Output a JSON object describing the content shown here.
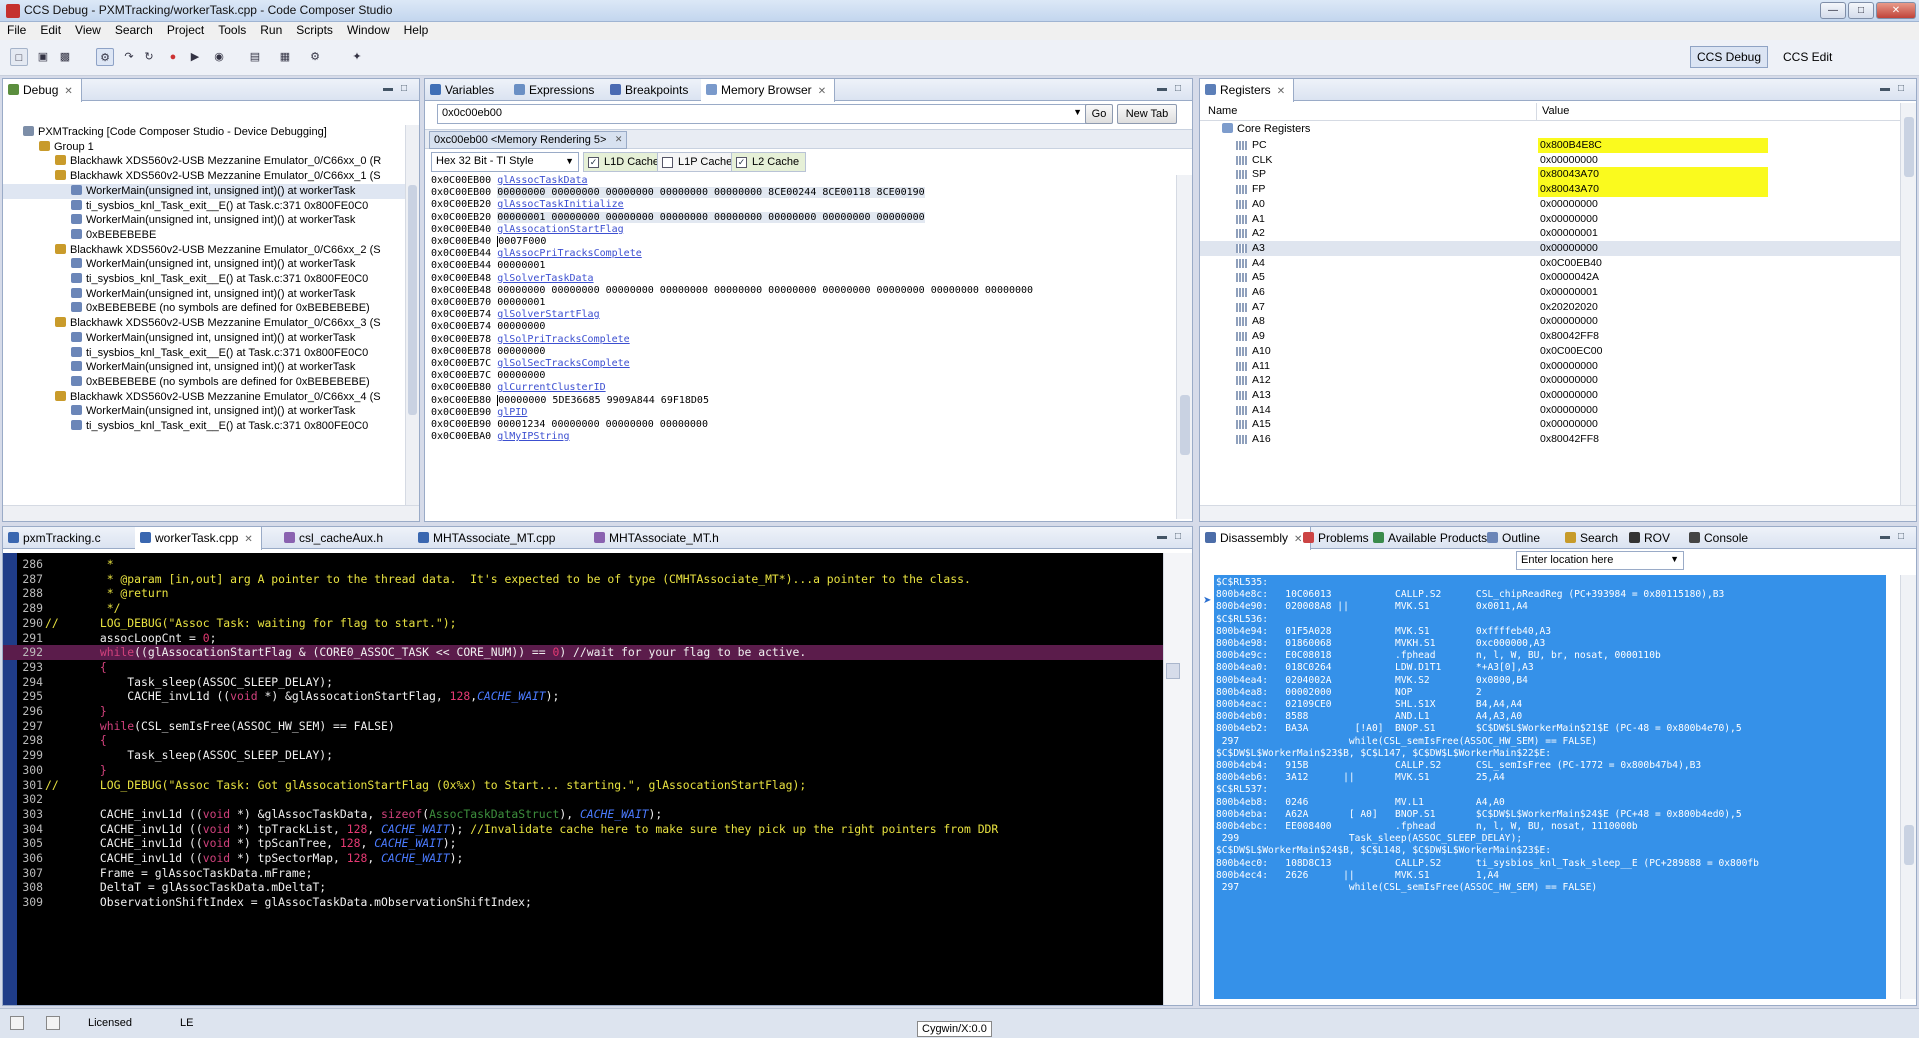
{
  "window": {
    "title": "CCS Debug - PXMTracking/workerTask.cpp - Code Composer Studio"
  },
  "menu": [
    "File",
    "Edit",
    "View",
    "Search",
    "Project",
    "Tools",
    "Run",
    "Scripts",
    "Window",
    "Help"
  ],
  "perspectives": [
    "CCS Debug",
    "CCS Edit"
  ],
  "debug_view": {
    "tab": "Debug",
    "rows": [
      {
        "indent": 0,
        "icon": "debug-session",
        "text": "PXMTracking [Code Composer Studio - Device Debugging]"
      },
      {
        "indent": 1,
        "icon": "group",
        "text": "Group 1"
      },
      {
        "indent": 2,
        "icon": "emulator",
        "text": "Blackhawk XDS560v2-USB Mezzanine Emulator_0/C66xx_0 (R"
      },
      {
        "indent": 2,
        "icon": "emulator",
        "text": "Blackhawk XDS560v2-USB Mezzanine Emulator_0/C66xx_1 (S"
      },
      {
        "indent": 3,
        "icon": "stack-frame",
        "text": "WorkerMain(unsigned int, unsigned int)() at workerTask",
        "selected": true
      },
      {
        "indent": 3,
        "icon": "stack-frame",
        "text": "ti_sysbios_knl_Task_exit__E() at Task.c:371 0x800FE0C0"
      },
      {
        "indent": 3,
        "icon": "stack-frame",
        "text": "WorkerMain(unsigned int, unsigned int)() at workerTask"
      },
      {
        "indent": 3,
        "icon": "stack-frame",
        "text": "0xBEBEBEBE"
      },
      {
        "indent": 2,
        "icon": "emulator",
        "text": "Blackhawk XDS560v2-USB Mezzanine Emulator_0/C66xx_2 (S"
      },
      {
        "indent": 3,
        "icon": "stack-frame",
        "text": "WorkerMain(unsigned int, unsigned int)() at workerTask"
      },
      {
        "indent": 3,
        "icon": "stack-frame",
        "text": "ti_sysbios_knl_Task_exit__E() at Task.c:371 0x800FE0C0"
      },
      {
        "indent": 3,
        "icon": "stack-frame",
        "text": "WorkerMain(unsigned int, unsigned int)() at workerTask"
      },
      {
        "indent": 3,
        "icon": "stack-frame",
        "text": "0xBEBEBEBE  (no symbols are defined for 0xBEBEBEBE)"
      },
      {
        "indent": 2,
        "icon": "emulator",
        "text": "Blackhawk XDS560v2-USB Mezzanine Emulator_0/C66xx_3 (S"
      },
      {
        "indent": 3,
        "icon": "stack-frame",
        "text": "WorkerMain(unsigned int, unsigned int)() at workerTask"
      },
      {
        "indent": 3,
        "icon": "stack-frame",
        "text": "ti_sysbios_knl_Task_exit__E() at Task.c:371 0x800FE0C0"
      },
      {
        "indent": 3,
        "icon": "stack-frame",
        "text": "WorkerMain(unsigned int, unsigned int)() at workerTask"
      },
      {
        "indent": 3,
        "icon": "stack-frame",
        "text": "0xBEBEBEBE  (no symbols are defined for 0xBEBEBEBE)"
      },
      {
        "indent": 2,
        "icon": "emulator",
        "text": "Blackhawk XDS560v2-USB Mezzanine Emulator_0/C66xx_4 (S"
      },
      {
        "indent": 3,
        "icon": "stack-frame",
        "text": "WorkerMain(unsigned int, unsigned int)() at workerTask"
      },
      {
        "indent": 3,
        "icon": "stack-frame",
        "text": "ti_sysbios_knl_Task_exit__E() at Task.c:371 0x800FE0C0"
      }
    ]
  },
  "memory_view": {
    "tabs": [
      "Variables",
      "Expressions",
      "Breakpoints",
      "Memory Browser"
    ],
    "address": "0x0c00eb00",
    "go_label": "Go",
    "newtab_label": "New Tab",
    "rendering_tab": "0xc00eb00 <Memory Rendering 5>",
    "format": "Hex 32 Bit - TI Style",
    "caches": [
      {
        "label": "L1D Cache",
        "checked": true
      },
      {
        "label": "L1P Cache",
        "checked": false
      },
      {
        "label": "L2 Cache",
        "checked": true
      }
    ],
    "rows": [
      {
        "addr": "0x0C00EB00",
        "sym": "glAssocTaskData"
      },
      {
        "addr": "0x0C00EB00",
        "data": "00000000 00000000 00000000 00000000 00000000 8CE00244 8CE00118 8CE00190",
        "sel": true
      },
      {
        "addr": "0x0C00EB20",
        "sym": "glAssocTaskInitialize"
      },
      {
        "addr": "0x0C00EB20",
        "data": "00000001 00000000 00000000 00000000 00000000 00000000 00000000 00000000",
        "sel": true
      },
      {
        "addr": "0x0C00EB40",
        "sym": "glAssocationStartFlag"
      },
      {
        "addr": "0x0C00EB40",
        "data": "0007F000",
        "cursor": true
      },
      {
        "addr": "0x0C00EB44",
        "sym": "glAssocPriTracksComplete"
      },
      {
        "addr": "0x0C00EB44",
        "data": "00000001"
      },
      {
        "addr": "0x0C00EB48",
        "sym": "glSolverTaskData"
      },
      {
        "addr": "0x0C00EB48",
        "data": "00000000 00000000 00000000 00000000 00000000 00000000 00000000 00000000 00000000 00000000"
      },
      {
        "addr": "0x0C00EB70",
        "data": "00000001"
      },
      {
        "addr": "0x0C00EB74",
        "sym": "glSolverStartFlag"
      },
      {
        "addr": "0x0C00EB74",
        "data": "00000000"
      },
      {
        "addr": "0x0C00EB78",
        "sym": "glSolPriTracksComplete"
      },
      {
        "addr": "0x0C00EB78",
        "data": "00000000"
      },
      {
        "addr": "0x0C00EB7C",
        "sym": "glSolSecTracksComplete"
      },
      {
        "addr": "0x0C00EB7C",
        "data": "00000000"
      },
      {
        "addr": "0x0C00EB80",
        "sym": "glCurrentClusterID"
      },
      {
        "addr": "0x0C00EB80",
        "data": "00000000 5DE36685 9909A844 69F18D05",
        "cursor": true
      },
      {
        "addr": "0x0C00EB90",
        "sym": "glPID"
      },
      {
        "addr": "0x0C00EB90",
        "data": "00001234 00000000 00000000 00000000"
      },
      {
        "addr": "0x0C00EBA0",
        "sym": "glMyIPString"
      }
    ]
  },
  "registers_view": {
    "tab": "Registers",
    "col_name": "Name",
    "col_value": "Value",
    "group": "Core Registers",
    "regs": [
      {
        "name": "PC",
        "value": "0x800B4E8C",
        "hl": true
      },
      {
        "name": "CLK",
        "value": "0x00000000"
      },
      {
        "name": "SP",
        "value": "0x80043A70",
        "hl": true
      },
      {
        "name": "FP",
        "value": "0x80043A70",
        "hl": true
      },
      {
        "name": "A0",
        "value": "0x00000000"
      },
      {
        "name": "A1",
        "value": "0x00000000"
      },
      {
        "name": "A2",
        "value": "0x00000001"
      },
      {
        "name": "A3",
        "value": "0x00000000",
        "sel": true
      },
      {
        "name": "A4",
        "value": "0x0C00EB40"
      },
      {
        "name": "A5",
        "value": "0x0000042A"
      },
      {
        "name": "A6",
        "value": "0x00000001"
      },
      {
        "name": "A7",
        "value": "0x20202020"
      },
      {
        "name": "A8",
        "value": "0x00000000"
      },
      {
        "name": "A9",
        "value": "0x80042FF8"
      },
      {
        "name": "A10",
        "value": "0x0C00EC00"
      },
      {
        "name": "A11",
        "value": "0x00000000"
      },
      {
        "name": "A12",
        "value": "0x00000000"
      },
      {
        "name": "A13",
        "value": "0x00000000"
      },
      {
        "name": "A14",
        "value": "0x00000000"
      },
      {
        "name": "A15",
        "value": "0x00000000"
      },
      {
        "name": "A16",
        "value": "0x80042FF8"
      }
    ]
  },
  "editor": {
    "tabs": [
      "pxmTracking.c",
      "workerTask.cpp",
      "csl_cacheAux.h",
      "MHTAssociate_MT.cpp",
      "MHTAssociate_MT.h"
    ],
    "lines": [
      {
        "n": "286",
        "t": [
          [
            "c-cmt",
            "         *"
          ]
        ]
      },
      {
        "n": "287",
        "t": [
          [
            "c-cmt",
            "         * @param [in,out] arg A pointer to the thread data.  It's expected to be of type (CMHTAssociate_MT*)...a pointer to the class."
          ]
        ]
      },
      {
        "n": "288",
        "t": [
          [
            "c-cmt",
            "         * @return"
          ]
        ]
      },
      {
        "n": "289",
        "t": [
          [
            "c-cmt",
            "         */"
          ]
        ]
      },
      {
        "n": "290",
        "t": [
          [
            "c-cmt",
            "//      LOG_DEBUG(\"Assoc Task: waiting for flag to start.\");"
          ]
        ]
      },
      {
        "n": "291",
        "t": [
          [
            "",
            "        assocLoopCnt = "
          ],
          [
            "c-num",
            "0"
          ],
          [
            "",
            ";"
          ]
        ]
      },
      {
        "n": "292",
        "hl": true,
        "t": [
          [
            "c-kw",
            "        while"
          ],
          [
            "",
            "((glAssocationStartFlag & (CORE0_ASSOC_TASK << CORE_NUM)) == "
          ],
          [
            "c-num",
            "0"
          ],
          [
            "",
            ") //wait for your flag to be active."
          ]
        ]
      },
      {
        "n": "293",
        "t": [
          [
            "c-kw",
            "        {"
          ]
        ]
      },
      {
        "n": "294",
        "t": [
          [
            "",
            "            Task_sleep(ASSOC_SLEEP_DELAY);"
          ]
        ]
      },
      {
        "n": "295",
        "t": [
          [
            "",
            "            CACHE_invL1d (("
          ],
          [
            "c-kw",
            "void"
          ],
          [
            "",
            " *) &glAssocationStartFlag, "
          ],
          [
            "c-num",
            "128"
          ],
          [
            "",
            ","
          ],
          [
            "c-mac",
            "CACHE_WAIT"
          ],
          [
            "",
            ");"
          ]
        ]
      },
      {
        "n": "296",
        "t": [
          [
            "c-kw",
            "        }"
          ]
        ]
      },
      {
        "n": "297",
        "t": [
          [
            "c-kw",
            "        while"
          ],
          [
            "",
            "(CSL_semIsFree(ASSOC_HW_SEM) == FALSE)"
          ]
        ]
      },
      {
        "n": "298",
        "t": [
          [
            "c-kw",
            "        {"
          ]
        ]
      },
      {
        "n": "299",
        "t": [
          [
            "",
            "            Task_sleep(ASSOC_SLEEP_DELAY);"
          ]
        ]
      },
      {
        "n": "300",
        "t": [
          [
            "c-kw",
            "        }"
          ]
        ]
      },
      {
        "n": "301",
        "t": [
          [
            "c-cmt",
            "//      LOG_DEBUG(\"Assoc Task: Got glAssocationStartFlag (0x%x) to Start... starting.\", glAssocationStartFlag);"
          ]
        ]
      },
      {
        "n": "302",
        "t": [
          [
            "",
            ""
          ]
        ]
      },
      {
        "n": "303",
        "t": [
          [
            "",
            "        CACHE_invL1d (("
          ],
          [
            "c-kw",
            "void"
          ],
          [
            "",
            " *) &glAssocTaskData, "
          ],
          [
            "c-kw",
            "sizeof"
          ],
          [
            "",
            "("
          ],
          [
            "c-grn",
            "AssocTaskDataStruct"
          ],
          [
            "",
            "), "
          ],
          [
            "c-mac",
            "CACHE_WAIT"
          ],
          [
            "",
            ");"
          ]
        ]
      },
      {
        "n": "304",
        "t": [
          [
            "",
            "        CACHE_invL1d (("
          ],
          [
            "c-kw",
            "void"
          ],
          [
            "",
            " *) tpTrackList, "
          ],
          [
            "c-num",
            "128"
          ],
          [
            "",
            ", "
          ],
          [
            "c-mac",
            "CACHE_WAIT"
          ],
          [
            "",
            "); "
          ],
          [
            "c-cmt",
            "//Invalidate cache here to make sure they pick up the right pointers from DDR"
          ]
        ]
      },
      {
        "n": "305",
        "t": [
          [
            "",
            "        CACHE_invL1d (("
          ],
          [
            "c-kw",
            "void"
          ],
          [
            "",
            " *) tpScanTree, "
          ],
          [
            "c-num",
            "128"
          ],
          [
            "",
            ", "
          ],
          [
            "c-mac",
            "CACHE_WAIT"
          ],
          [
            "",
            ");"
          ]
        ]
      },
      {
        "n": "306",
        "t": [
          [
            "",
            "        CACHE_invL1d (("
          ],
          [
            "c-kw",
            "void"
          ],
          [
            "",
            " *) tpSectorMap, "
          ],
          [
            "c-num",
            "128"
          ],
          [
            "",
            ", "
          ],
          [
            "c-mac",
            "CACHE_WAIT"
          ],
          [
            "",
            ");"
          ]
        ]
      },
      {
        "n": "307",
        "t": [
          [
            "",
            "        Frame = glAssocTaskData.mFrame;"
          ]
        ]
      },
      {
        "n": "308",
        "t": [
          [
            "",
            "        DeltaT = glAssocTaskData.mDeltaT;"
          ]
        ]
      },
      {
        "n": "309",
        "t": [
          [
            "",
            "        ObservationShiftIndex = glAssocTaskData.mObservationShiftIndex;"
          ]
        ]
      }
    ]
  },
  "bottom_views": {
    "tabs": [
      "Disassembly",
      "Problems",
      "Available Products",
      "Outline",
      "Search",
      "ROV",
      "Console"
    ],
    "location_placeholder": "Enter location here",
    "lines": [
      "$C$RL535:",
      "800b4e8c:   10C06013           CALLP.S2      CSL_chipReadReg (PC+393984 = 0x80115180),B3",
      "800b4e90:   020008A8 ||        MVK.S1        0x0011,A4",
      "$C$RL536:",
      "800b4e94:   01F5A028           MVK.S1        0xffffeb40,A3",
      "800b4e98:   01860068           MVKH.S1       0xc000000,A3",
      "800b4e9c:   E0C08018           .fphead       n, l, W, BU, br, nosat, 0000110b",
      "800b4ea0:   018C0264           LDW.D1T1      *+A3[0],A3",
      "800b4ea4:   0204002A           MVK.S2        0x0800,B4",
      "800b4ea8:   00002000           NOP           2",
      "800b4eac:   02109CE0           SHL.S1X       B4,A4,A4",
      "800b4eb0:   8588               AND.L1        A4,A3,A0",
      "800b4eb2:   BA3A        [!A0]  BNOP.S1       $C$DW$L$WorkerMain$21$E (PC-48 = 0x800b4e70),5",
      " 297                   while(CSL_semIsFree(ASSOC_HW_SEM) == FALSE)",
      "$C$DW$L$WorkerMain$23$B, $C$L147, $C$DW$L$WorkerMain$22$E:",
      "800b4eb4:   915B               CALLP.S2      CSL_semIsFree (PC-1772 = 0x800b47b4),B3",
      "800b4eb6:   3A12      ||       MVK.S1        25,A4",
      "$C$RL537:",
      "800b4eb8:   0246               MV.L1         A4,A0",
      "800b4eba:   A62A       [ A0]   BNOP.S1       $C$DW$L$WorkerMain$24$E (PC+48 = 0x800b4ed0),5",
      "800b4ebc:   EE008400           .fphead       n, l, W, BU, nosat, 1110000b",
      " 299                   Task_sleep(ASSOC_SLEEP_DELAY);",
      "$C$DW$L$WorkerMain$24$B, $C$L148, $C$DW$L$WorkerMain$23$E:",
      "800b4ec0:   108D8C13           CALLP.S2      ti_sysbios_knl_Task_sleep__E (PC+289888 = 0x800fb",
      "800b4ec4:   2626      ||       MVK.S1        1,A4",
      " 297                   while(CSL_semIsFree(ASSOC_HW_SEM) == FALSE)"
    ]
  },
  "status": {
    "licensed": "Licensed",
    "endian": "LE",
    "tooltip": "Cygwin/X:0.0"
  }
}
